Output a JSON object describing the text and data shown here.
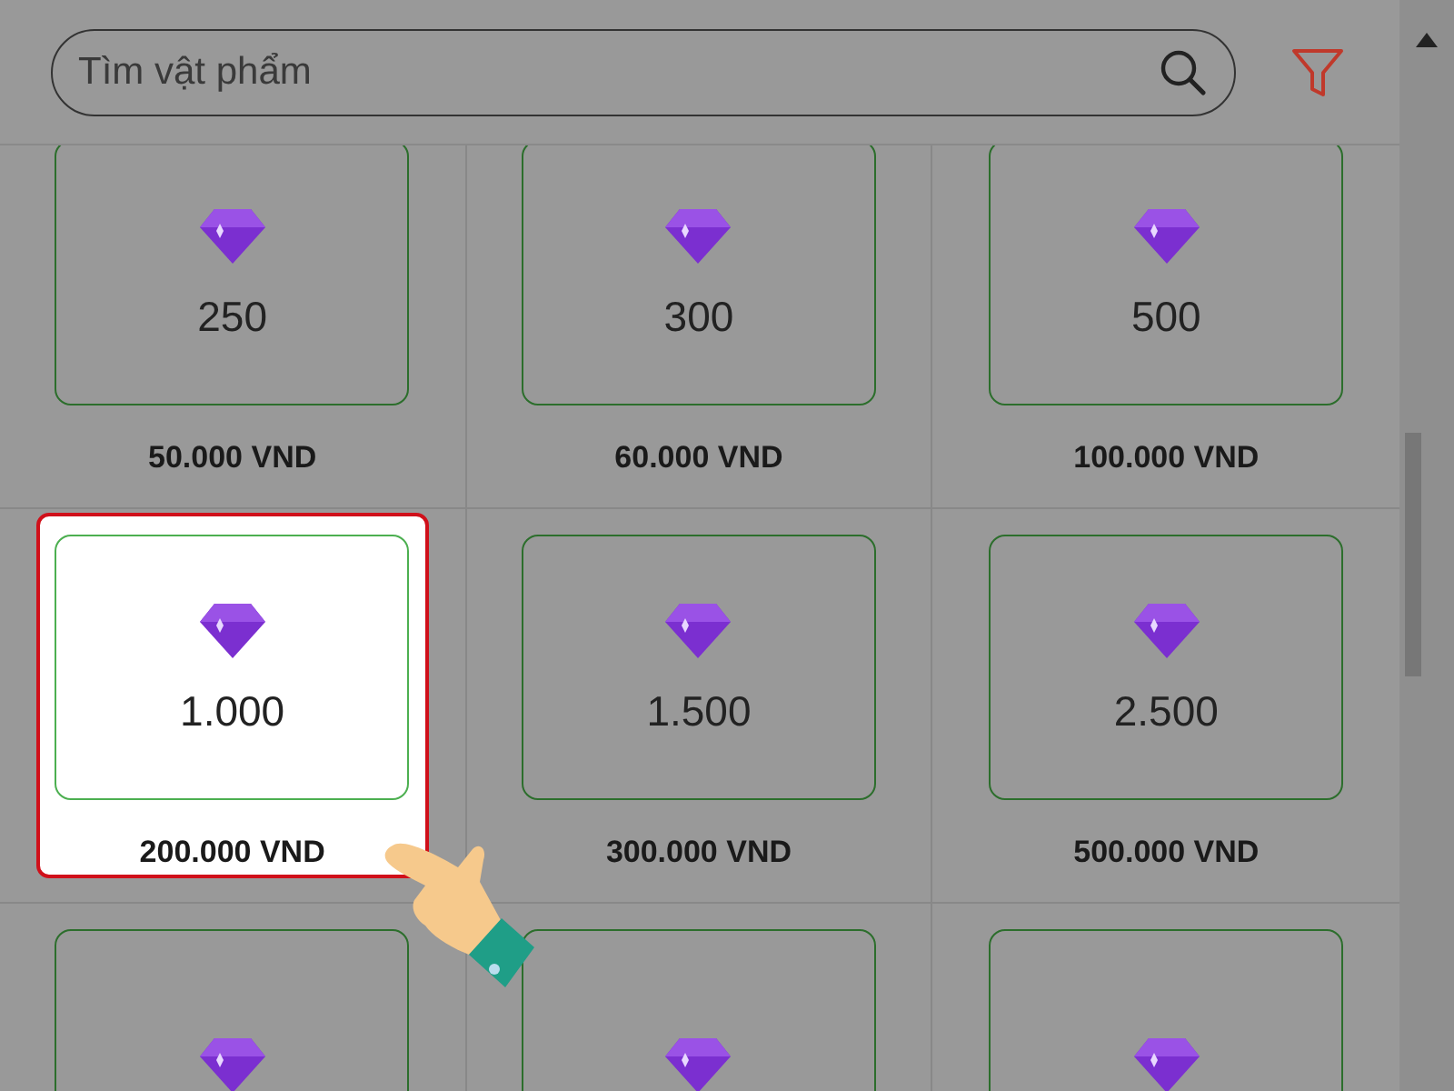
{
  "search": {
    "placeholder": "Tìm vật phẩm"
  },
  "items": [
    {
      "amount": "250",
      "price": "50.000 VND",
      "selected": false
    },
    {
      "amount": "300",
      "price": "60.000 VND",
      "selected": false
    },
    {
      "amount": "500",
      "price": "100.000 VND",
      "selected": false
    },
    {
      "amount": "1.000",
      "price": "200.000 VND",
      "selected": true
    },
    {
      "amount": "1.500",
      "price": "300.000 VND",
      "selected": false
    },
    {
      "amount": "2.500",
      "price": "500.000 VND",
      "selected": false
    },
    {
      "selected": false
    },
    {
      "selected": false
    },
    {
      "selected": false
    }
  ]
}
